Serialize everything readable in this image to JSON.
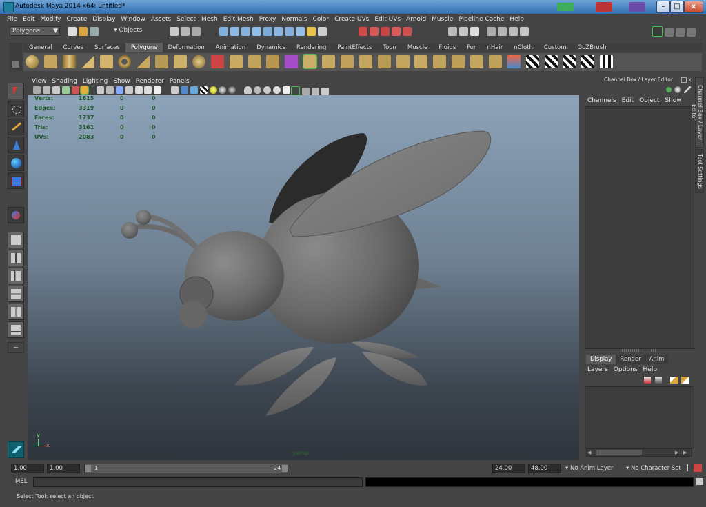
{
  "window": {
    "title": "Autodesk Maya 2014 x64: untitled*",
    "minimize_glyph": "–",
    "maximize_glyph": "□",
    "close_glyph": "x"
  },
  "menubar": [
    "File",
    "Edit",
    "Modify",
    "Create",
    "Display",
    "Window",
    "Assets",
    "Select",
    "Mesh",
    "Edit Mesh",
    "Proxy",
    "Normals",
    "Color",
    "Create UVs",
    "Edit UVs",
    "Arnold",
    "Muscle",
    "Pipeline Cache",
    "Help"
  ],
  "status_line": {
    "menu_set": "Polygons",
    "selection_mode": "Objects"
  },
  "shelf": {
    "tabs": [
      "General",
      "Curves",
      "Surfaces",
      "Polygons",
      "Deformation",
      "Animation",
      "Dynamics",
      "Rendering",
      "PaintEffects",
      "Toon",
      "Muscle",
      "Fluids",
      "Fur",
      "nHair",
      "nCloth",
      "Custom",
      "GoZBrush"
    ],
    "active_tab": "Polygons"
  },
  "viewport": {
    "menu": [
      "View",
      "Shading",
      "Lighting",
      "Show",
      "Renderer",
      "Panels"
    ],
    "camera_label": "persp",
    "hud": [
      {
        "label": "Verts:",
        "c1": "1615",
        "c2": "0",
        "c3": "0"
      },
      {
        "label": "Edges:",
        "c1": "3319",
        "c2": "0",
        "c3": "0"
      },
      {
        "label": "Faces:",
        "c1": "1737",
        "c2": "0",
        "c3": "0"
      },
      {
        "label": "Tris:",
        "c1": "3161",
        "c2": "0",
        "c3": "0"
      },
      {
        "label": "UVs:",
        "c1": "2083",
        "c2": "0",
        "c3": "0"
      }
    ],
    "axis_y": "y",
    "axis_x": "x"
  },
  "channel_box": {
    "title": "Channel Box / Layer Editor",
    "menu": [
      "Channels",
      "Edit",
      "Object",
      "Show"
    ],
    "side_tabs": [
      "Channel Box / Layer Editor",
      "Tool Settings"
    ]
  },
  "layer_editor": {
    "tabs": [
      "Display",
      "Render",
      "Anim"
    ],
    "active_tab": "Display",
    "menu": [
      "Layers",
      "Options",
      "Help"
    ]
  },
  "time_slider": {
    "start": "1.00",
    "playback_start": "1.00",
    "range_start": "1",
    "range_end": "24",
    "playback_end": "24.00",
    "end": "48.00",
    "anim_layer": "No Anim Layer",
    "character_set": "No Character Set"
  },
  "command_line": {
    "label": "MEL"
  },
  "help_line": "Select Tool: select an object",
  "colors": {
    "ui_bg": "#444444",
    "title_blue": "#2f6fb0",
    "hud_green": "#1f5b2a",
    "model_gray": "#6e6e6e"
  }
}
